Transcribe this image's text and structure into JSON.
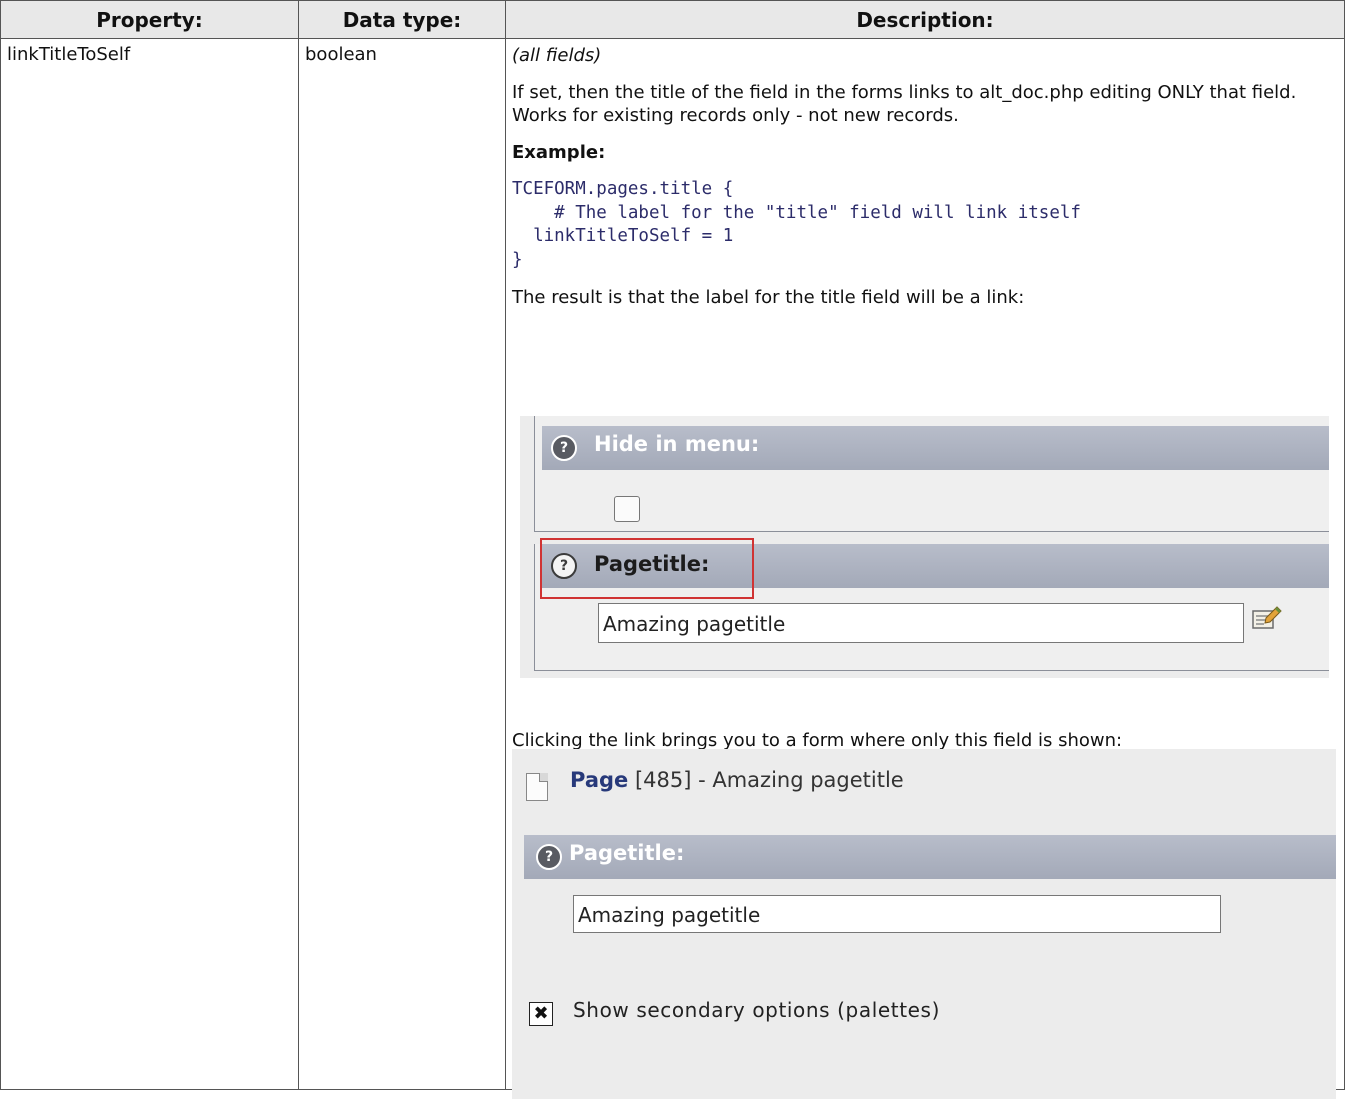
{
  "headers": {
    "property": "Property:",
    "data_type": "Data type:",
    "description": "Description:"
  },
  "row": {
    "property": "linkTitleToSelf",
    "data_type": "boolean",
    "scope": "(all fields)",
    "para1": "If set, then the title of the field in the forms links to alt_doc.php editing ONLY that field.",
    "para2": "Works for existing records only - not new records.",
    "example_label": "Example:",
    "code": "TCEFORM.pages.title {\n    # The label for the \"title\" field will link itself\n  linkTitleToSelf = 1\n}",
    "result_text": "The result is that the label for the title field will be a link:",
    "clicking_text": "Clicking the link brings you to a form where only this field is shown:"
  },
  "screenshot1": {
    "help_glyph": "?",
    "hide_in_menu_label": "Hide in menu:",
    "hide_in_menu_checked": false,
    "pagetitle_label": "Pagetitle:",
    "pagetitle_value": "Amazing pagetitle",
    "highlight_color": "#d03333",
    "edit_icon": "edit-record-icon"
  },
  "screenshot2": {
    "help_glyph": "?",
    "record_type": "Page",
    "record_rest": " [485] - Amazing pagetitle",
    "pagetitle_label": "Pagetitle:",
    "pagetitle_value": "Amazing pagetitle",
    "secondary_checked": true,
    "secondary_check_glyph": "✖",
    "secondary_label": "Show secondary options (palettes)",
    "document_icon": "document-icon"
  }
}
